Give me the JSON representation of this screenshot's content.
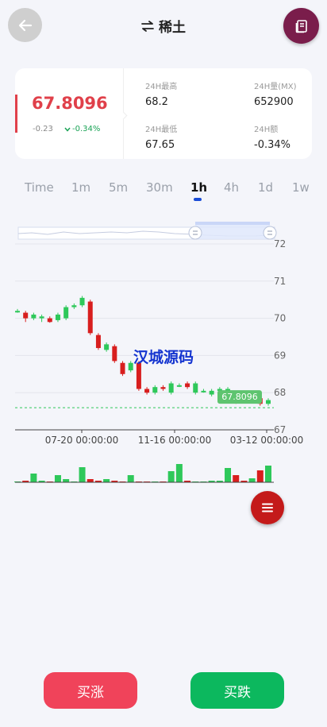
{
  "header": {
    "title": "稀土",
    "back_icon": "arrow-left-icon",
    "swap_icon": "swap-arrows-icon",
    "book_icon": "book-icon"
  },
  "quote": {
    "price": "67.8096",
    "change_abs": "-0.23",
    "change_pct": "-0.34%",
    "stats": [
      {
        "label": "24H最高",
        "value": "68.2"
      },
      {
        "label": "24H量(MX)",
        "value": "652900"
      },
      {
        "label": "24H最低",
        "value": "67.65"
      },
      {
        "label": "24H额",
        "value": "-0.34%"
      }
    ]
  },
  "intervals": [
    "Time",
    "1m",
    "5m",
    "30m",
    "1h",
    "4h",
    "1d",
    "1w"
  ],
  "active_interval": "1h",
  "chart_data": {
    "type": "candlestick",
    "y_ticks": [
      "72",
      "71",
      "70",
      "69",
      "68",
      "67"
    ],
    "ylim": [
      67,
      72
    ],
    "x_ticks": [
      "07-20 00:00:00",
      "11-16 00:00:00",
      "03-12 00:00:00"
    ],
    "last_price_label": "67.8096",
    "watermark": "汉城源码",
    "candles": [
      {
        "o": 70.2,
        "c": 70.2,
        "h": 70.25,
        "l": 70.15
      },
      {
        "o": 70.15,
        "c": 70.0,
        "h": 70.2,
        "l": 69.9
      },
      {
        "o": 70.0,
        "c": 70.1,
        "h": 70.15,
        "l": 69.95
      },
      {
        "o": 70.0,
        "c": 70.05,
        "h": 70.1,
        "l": 69.9
      },
      {
        "o": 70.0,
        "c": 69.9,
        "h": 70.05,
        "l": 69.88
      },
      {
        "o": 69.95,
        "c": 70.1,
        "h": 70.15,
        "l": 69.9
      },
      {
        "o": 70.0,
        "c": 70.3,
        "h": 70.35,
        "l": 69.95
      },
      {
        "o": 70.3,
        "c": 70.35,
        "h": 70.4,
        "l": 70.25
      },
      {
        "o": 70.35,
        "c": 70.55,
        "h": 70.6,
        "l": 70.3
      },
      {
        "o": 70.45,
        "c": 69.6,
        "h": 70.5,
        "l": 69.55
      },
      {
        "o": 69.55,
        "c": 69.2,
        "h": 69.6,
        "l": 69.15
      },
      {
        "o": 69.15,
        "c": 69.3,
        "h": 69.35,
        "l": 69.1
      },
      {
        "o": 69.25,
        "c": 68.85,
        "h": 69.3,
        "l": 68.8
      },
      {
        "o": 68.8,
        "c": 68.5,
        "h": 68.85,
        "l": 68.45
      },
      {
        "o": 68.6,
        "c": 68.8,
        "h": 68.85,
        "l": 68.55
      },
      {
        "o": 68.8,
        "c": 68.1,
        "h": 68.85,
        "l": 68.05
      },
      {
        "o": 68.1,
        "c": 68.0,
        "h": 68.15,
        "l": 67.95
      },
      {
        "o": 68.0,
        "c": 68.15,
        "h": 68.2,
        "l": 67.95
      },
      {
        "o": 68.15,
        "c": 68.1,
        "h": 68.2,
        "l": 68.05
      },
      {
        "o": 68.0,
        "c": 68.25,
        "h": 68.3,
        "l": 67.95
      },
      {
        "o": 68.2,
        "c": 68.2,
        "h": 68.25,
        "l": 68.15
      },
      {
        "o": 68.25,
        "c": 68.15,
        "h": 68.3,
        "l": 68.1
      },
      {
        "o": 68.0,
        "c": 68.25,
        "h": 68.3,
        "l": 67.95
      },
      {
        "o": 68.05,
        "c": 68.05,
        "h": 68.1,
        "l": 68.0
      },
      {
        "o": 67.95,
        "c": 68.05,
        "h": 68.1,
        "l": 67.9
      },
      {
        "o": 68.05,
        "c": 68.1,
        "h": 68.15,
        "l": 68.0
      },
      {
        "o": 68.05,
        "c": 68.1,
        "h": 68.15,
        "l": 68.0
      },
      {
        "o": 67.95,
        "c": 67.75,
        "h": 68.0,
        "l": 67.7
      },
      {
        "o": 67.82,
        "c": 67.8,
        "h": 67.85,
        "l": 67.75
      },
      {
        "o": 67.8,
        "c": 67.85,
        "h": 67.88,
        "l": 67.78
      },
      {
        "o": 67.85,
        "c": 67.7,
        "h": 67.9,
        "l": 67.65
      },
      {
        "o": 67.7,
        "c": 67.8,
        "h": 67.85,
        "l": 67.65
      }
    ],
    "volumes": [
      0.05,
      0.1,
      0.55,
      0.1,
      0.05,
      0.45,
      0.2,
      0.05,
      0.95,
      0.2,
      0.1,
      0.2,
      0.1,
      0.05,
      0.45,
      0.05,
      0.05,
      0.05,
      0.05,
      0.7,
      1.15,
      0.1,
      0.05,
      0.05,
      0.1,
      0.1,
      0.9,
      0.45,
      0.1,
      0.25,
      0.75,
      1.05
    ]
  },
  "colors": {
    "up": "#2ec85a",
    "down": "#d81e1e",
    "price": "#e0404a",
    "accent": "#1a4cd6"
  },
  "actions": {
    "buy_up": "买涨",
    "buy_down": "买跌",
    "menu_icon": "menu-lines-icon"
  }
}
